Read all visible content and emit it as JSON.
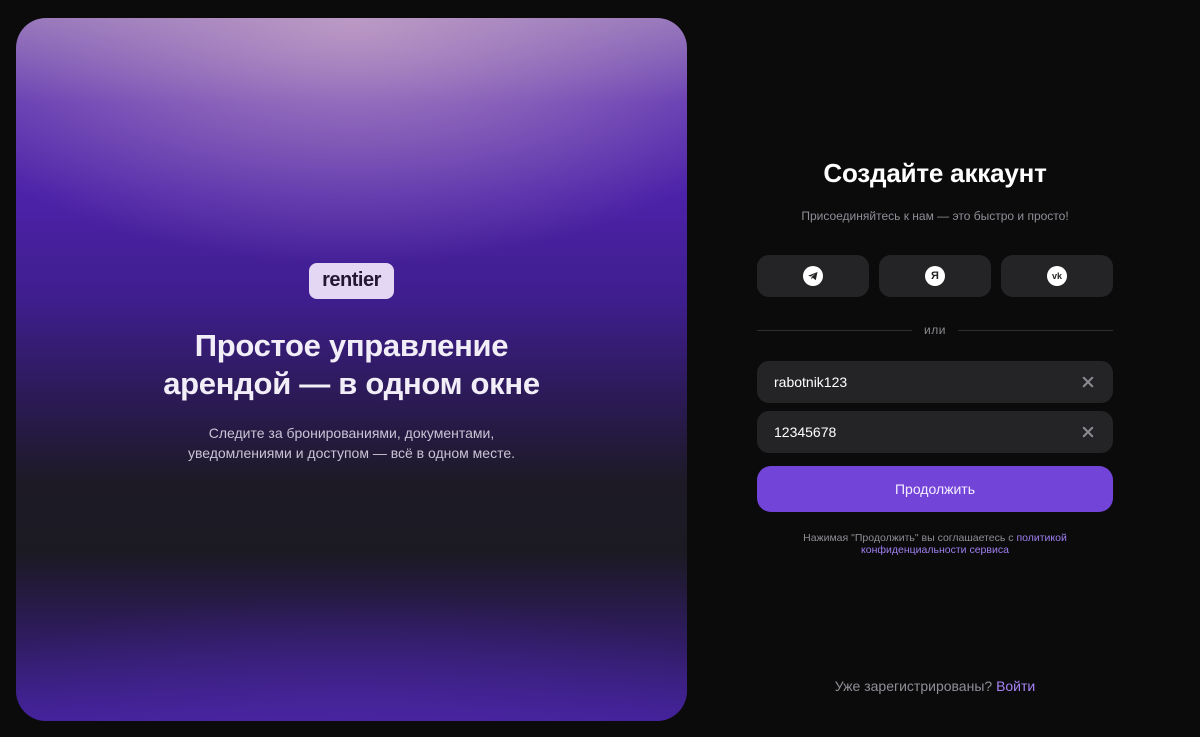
{
  "hero": {
    "logo": "rentier",
    "title": "Простое управление арендой — в одном окне",
    "subtitle": "Следите за бронированиями, документами, уведомлениями и доступом — всё в одном месте."
  },
  "form": {
    "title": "Создайте аккаунт",
    "subtitle": "Присоединяйтесь к нам — это быстро и просто!",
    "socials": [
      {
        "name": "telegram",
        "icon": "telegram-icon"
      },
      {
        "name": "yandex",
        "icon": "yandex-icon",
        "glyph": "Я"
      },
      {
        "name": "vk",
        "icon": "vk-icon",
        "glyph": "vk"
      }
    ],
    "divider": "или",
    "login_value": "rabotnik123",
    "password_value": "12345678",
    "submit_label": "Продолжить",
    "terms_prefix": "Нажимая \"Продолжить\" вы соглашаетесь с ",
    "terms_link": "политикой конфиденциальности сервиса"
  },
  "footer": {
    "question": "Уже зарегистрированы? ",
    "link": "Войти"
  },
  "colors": {
    "accent": "#7344d8",
    "link": "#a783f5",
    "background": "#0b0b0c",
    "field": "#242426"
  }
}
